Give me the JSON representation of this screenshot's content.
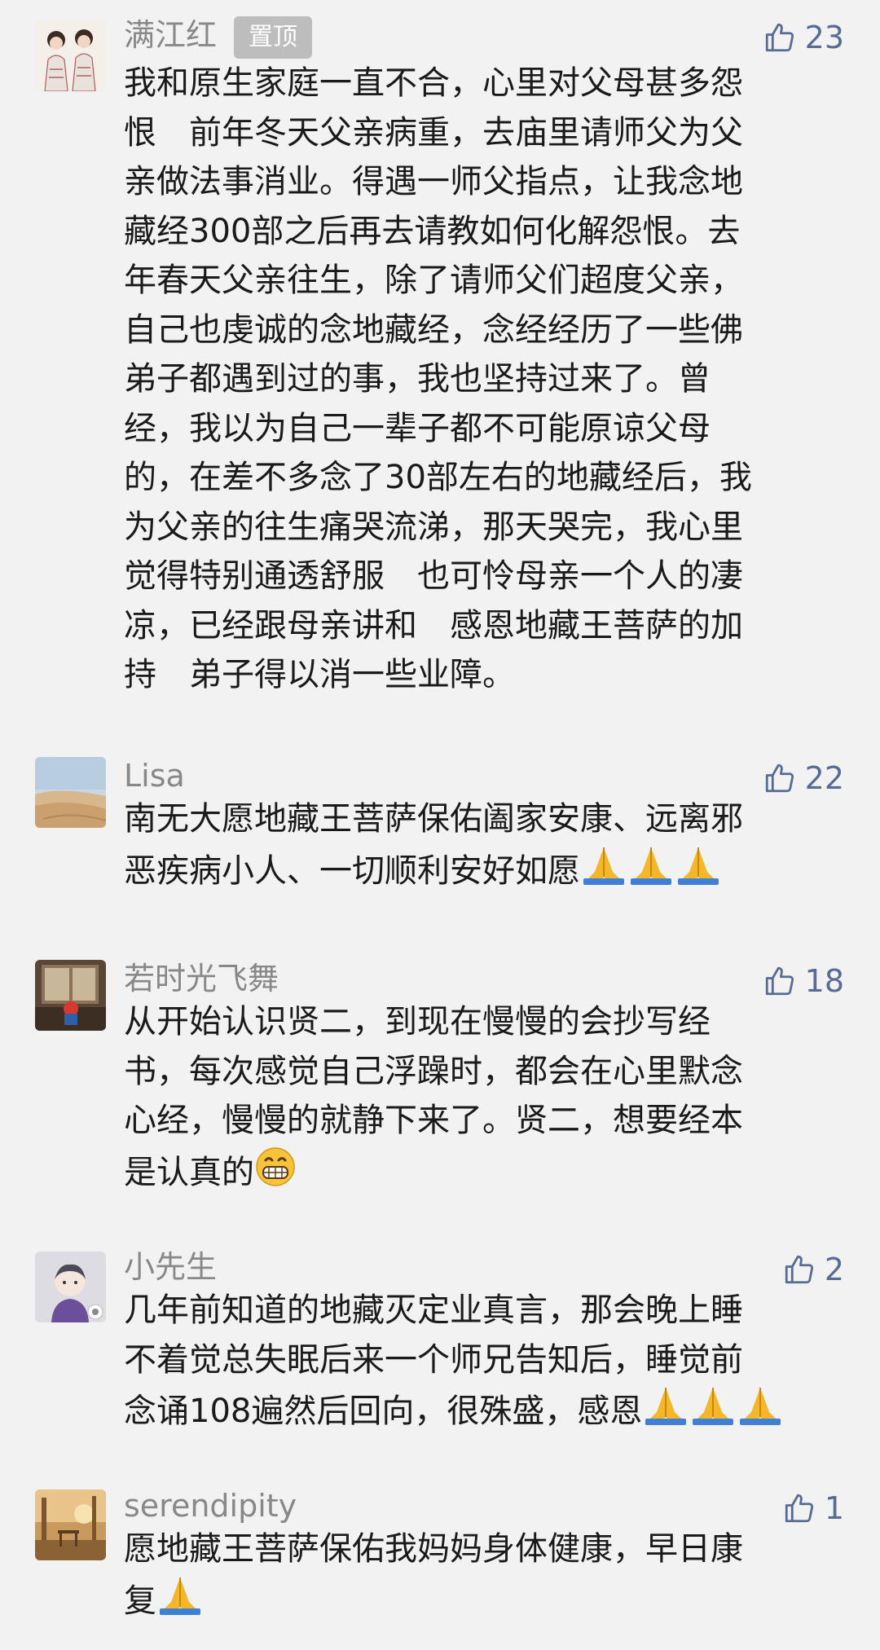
{
  "comments": [
    {
      "nickname": "满江红",
      "badge": "置顶",
      "likes": "23",
      "avatar": "two-women-portrait",
      "text": "我和原生家庭一直不合，心里对父母甚多怨\n恨　前年冬天父亲病重，去庙里请师父为父\n亲做法事消业。得遇一师父指点，让我念地\n藏经300部之后再去请教如何化解怨恨。去\n年春天父亲往生，除了请师父们超度父亲，\n自己也虔诚的念地藏经，念经经历了一些佛\n弟子都遇到过的事，我也坚持过来了。曾\n经，我以为自己一辈子都不可能原谅父母\n的，在差不多念了30部左右的地藏经后，我\n为父亲的往生痛哭流涕，那天哭完，我心里\n觉得特别通透舒服　也可怜母亲一个人的凄\n凉，已经跟母亲讲和　感恩地藏王菩萨的加\n持　弟子得以消一些业障。"
    },
    {
      "nickname": "Lisa",
      "likes": "22",
      "avatar": "desert-landscape",
      "text": "南无大愿地藏王菩萨保佑阖家安康、远离邪\n恶疾病小人、一切顺利安好如愿",
      "emoji": [
        "folded-hands",
        "folded-hands",
        "folded-hands"
      ]
    },
    {
      "nickname": "若时光飞舞",
      "likes": "18",
      "avatar": "window-toy-photo",
      "text": "从开始认识贤二，到现在慢慢的会抄写经\n书，每次感觉自己浮躁时，都会在心里默念\n心经，慢慢的就静下来了。贤二，想要经本\n是认真的",
      "emoji": [
        "grinning-face"
      ]
    },
    {
      "nickname": "小先生",
      "likes": "2",
      "avatar": "cartoon-boy",
      "text": "几年前知道的地藏灭定业真言，那会晚上睡\n不着觉总失眠后来一个师兄告知后，睡觉前\n念诵108遍然后回向，很殊盛，感恩",
      "emoji": [
        "folded-hands",
        "folded-hands",
        "folded-hands"
      ]
    },
    {
      "nickname": "serendipity",
      "likes": "1",
      "avatar": "sunset-cafe-photo",
      "text": "愿地藏王菩萨保佑我妈妈身体健康，早日康\n复",
      "emoji": [
        "folded-hands"
      ]
    }
  ],
  "colors": {
    "background": "#f2f2f2",
    "nickname": "#888888",
    "like": "#576b95",
    "text": "#1a1a1a",
    "badge_bg": "#bdbdbd"
  },
  "icons": {
    "like": "thumbs-up-icon",
    "prayer": "folded-hands-emoji",
    "grin": "grinning-face-emoji"
  }
}
